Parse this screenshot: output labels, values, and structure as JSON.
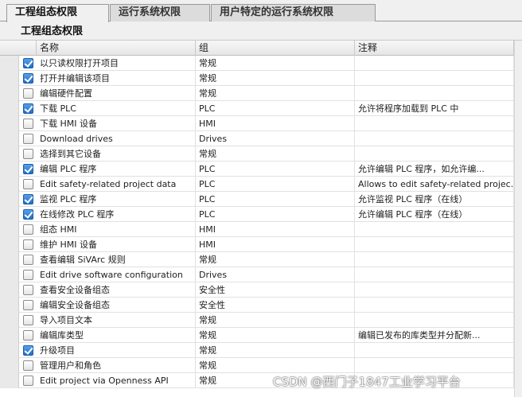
{
  "tabs": [
    {
      "label": "工程组态权限",
      "active": true
    },
    {
      "label": "运行系统权限",
      "active": false
    },
    {
      "label": "用户特定的运行系统权限",
      "active": false
    }
  ],
  "section_title": "工程组态权限",
  "columns": {
    "name": "名称",
    "group": "组",
    "note": "注释"
  },
  "rows": [
    {
      "checked": true,
      "name": "以只读权限打开项目",
      "group": "常规",
      "note": ""
    },
    {
      "checked": true,
      "name": "打开并编辑该项目",
      "group": "常规",
      "note": ""
    },
    {
      "checked": false,
      "name": "编辑硬件配置",
      "group": "常规",
      "note": ""
    },
    {
      "checked": true,
      "name": "下载 PLC",
      "group": "PLC",
      "note": "允许将程序加载到 PLC 中"
    },
    {
      "checked": false,
      "name": "下载 HMI 设备",
      "group": "HMI",
      "note": ""
    },
    {
      "checked": false,
      "name": "Download drives",
      "group": "Drives",
      "note": ""
    },
    {
      "checked": false,
      "name": "选择到其它设备",
      "group": "常规",
      "note": ""
    },
    {
      "checked": true,
      "name": "编辑 PLC 程序",
      "group": "PLC",
      "note": "允许编辑 PLC 程序，如允许编..."
    },
    {
      "checked": false,
      "name": "Edit safety-related project data",
      "group": "PLC",
      "note": "Allows to edit safety-related projec..."
    },
    {
      "checked": true,
      "name": "监视 PLC 程序",
      "group": "PLC",
      "note": "允许监视 PLC 程序（在线）"
    },
    {
      "checked": true,
      "name": "在线修改 PLC 程序",
      "group": "PLC",
      "note": "允许编辑 PLC 程序（在线）"
    },
    {
      "checked": false,
      "name": "组态 HMI",
      "group": "HMI",
      "note": ""
    },
    {
      "checked": false,
      "name": "维护 HMI 设备",
      "group": "HMI",
      "note": ""
    },
    {
      "checked": false,
      "name": "查看编辑 SiVArc 规则",
      "group": "常规",
      "note": ""
    },
    {
      "checked": false,
      "name": "Edit drive software configuration",
      "group": "Drives",
      "note": ""
    },
    {
      "checked": false,
      "name": "查看安全设备组态",
      "group": "安全性",
      "note": ""
    },
    {
      "checked": false,
      "name": "编辑安全设备组态",
      "group": "安全性",
      "note": ""
    },
    {
      "checked": false,
      "name": "导入项目文本",
      "group": "常规",
      "note": ""
    },
    {
      "checked": false,
      "name": "编辑库类型",
      "group": "常规",
      "note": "编辑已发布的库类型并分配新..."
    },
    {
      "checked": true,
      "name": "升级项目",
      "group": "常规",
      "note": ""
    },
    {
      "checked": false,
      "name": "管理用户和角色",
      "group": "常规",
      "note": ""
    },
    {
      "checked": false,
      "name": "Edit project via Openness API",
      "group": "常规",
      "note": ""
    }
  ],
  "watermark": "CSDN @西门子1847工业学习平台"
}
